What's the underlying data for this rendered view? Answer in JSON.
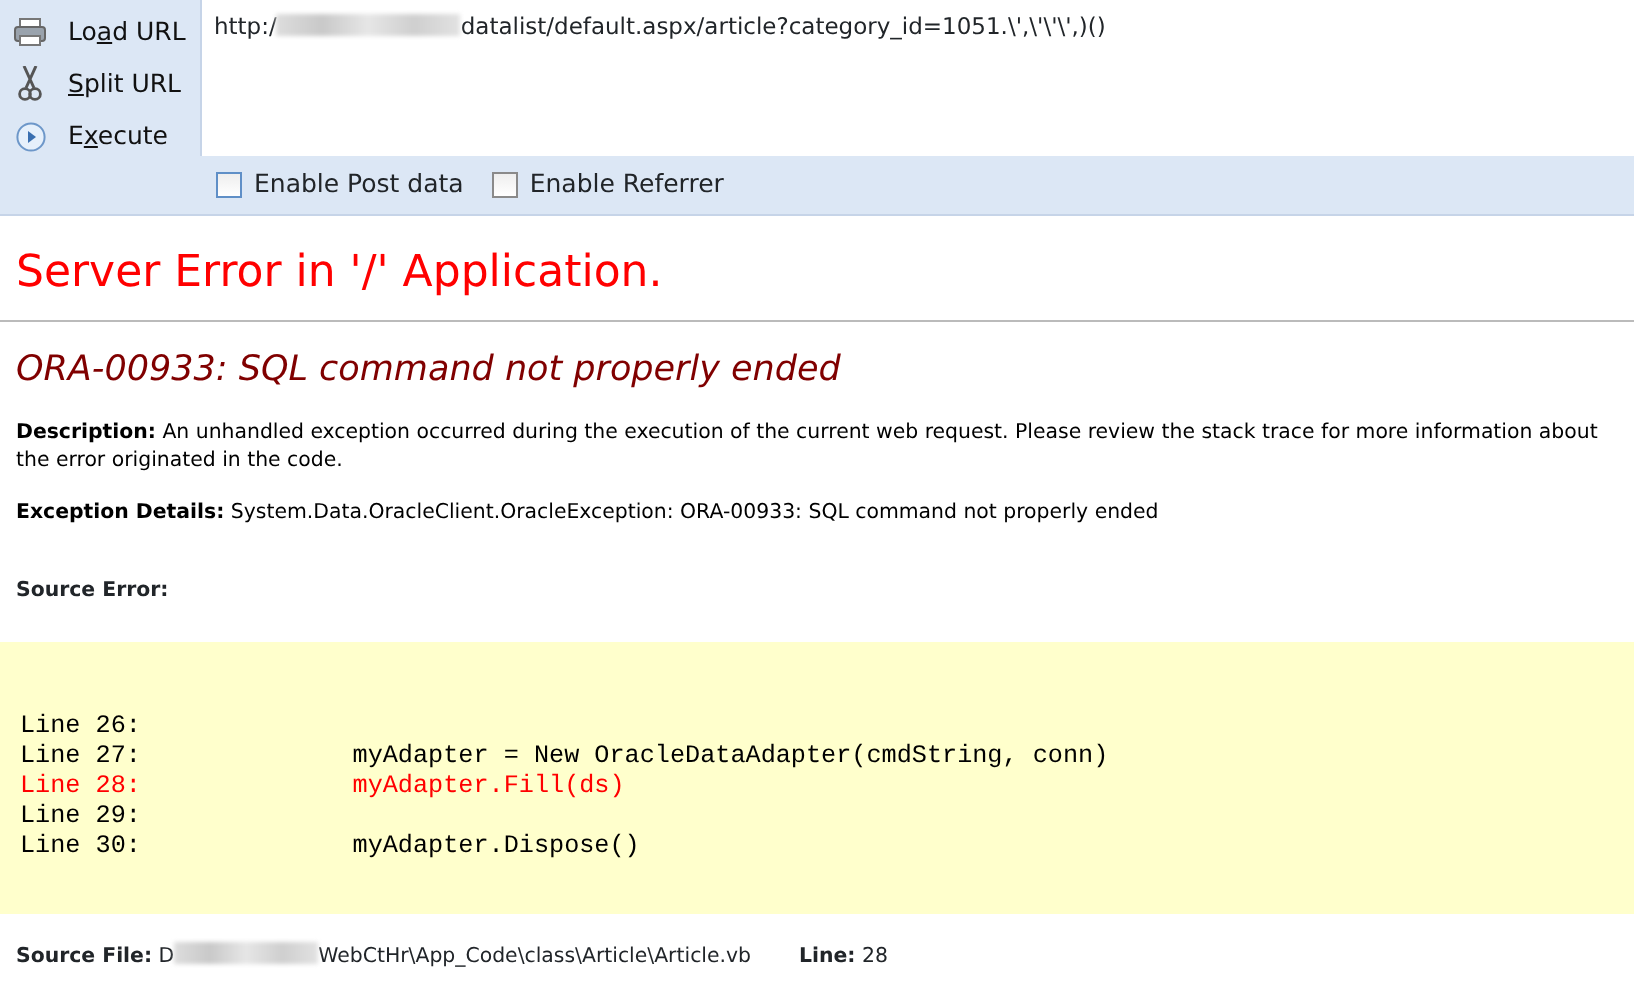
{
  "toolbar": {
    "actions": [
      {
        "kind": "load",
        "before": "Lo",
        "mnemonic": "a",
        "after": "d URL"
      },
      {
        "kind": "split",
        "mnemonic": "S",
        "after": "plit URL"
      },
      {
        "kind": "execute",
        "before": "E",
        "mnemonic": "x",
        "after": "ecute"
      }
    ],
    "url": {
      "start": "http:/",
      "end": "datalist/default.aspx/article?category_id=1051.\\',\\'\\'\\',)()"
    },
    "options": [
      {
        "label": "Enable Post data",
        "checked": false
      },
      {
        "label": "Enable Referrer",
        "checked": false
      }
    ]
  },
  "error_page": {
    "title": "Server Error in '/' Application.",
    "message": "ORA-00933: SQL command not properly ended",
    "description": {
      "label": "Description:",
      "text": "An unhandled exception occurred during the execution of the current web request. Please review the stack trace for more information about the error originated in the code."
    },
    "exception_details": {
      "label": "Exception Details:",
      "text": "System.Data.OracleClient.OracleException: ORA-00933: SQL command not properly ended"
    },
    "source_error_label": "Source Error:",
    "source_lines": [
      {
        "text": "Line 26:",
        "highlighted": false
      },
      {
        "text": "Line 27:              myAdapter = New OracleDataAdapter(cmdString, conn)",
        "highlighted": false
      },
      {
        "text": "Line 28:              myAdapter.Fill(ds)",
        "highlighted": true
      },
      {
        "text": "Line 29:",
        "highlighted": false
      },
      {
        "text": "Line 30:              myAdapter.Dispose()",
        "highlighted": false
      }
    ],
    "source_file": {
      "label": "Source File:",
      "start": "D",
      "end": "WebCtHr\\App_Code\\class\\Article\\Article.vb",
      "line_label": "Line:",
      "line": "28"
    }
  }
}
